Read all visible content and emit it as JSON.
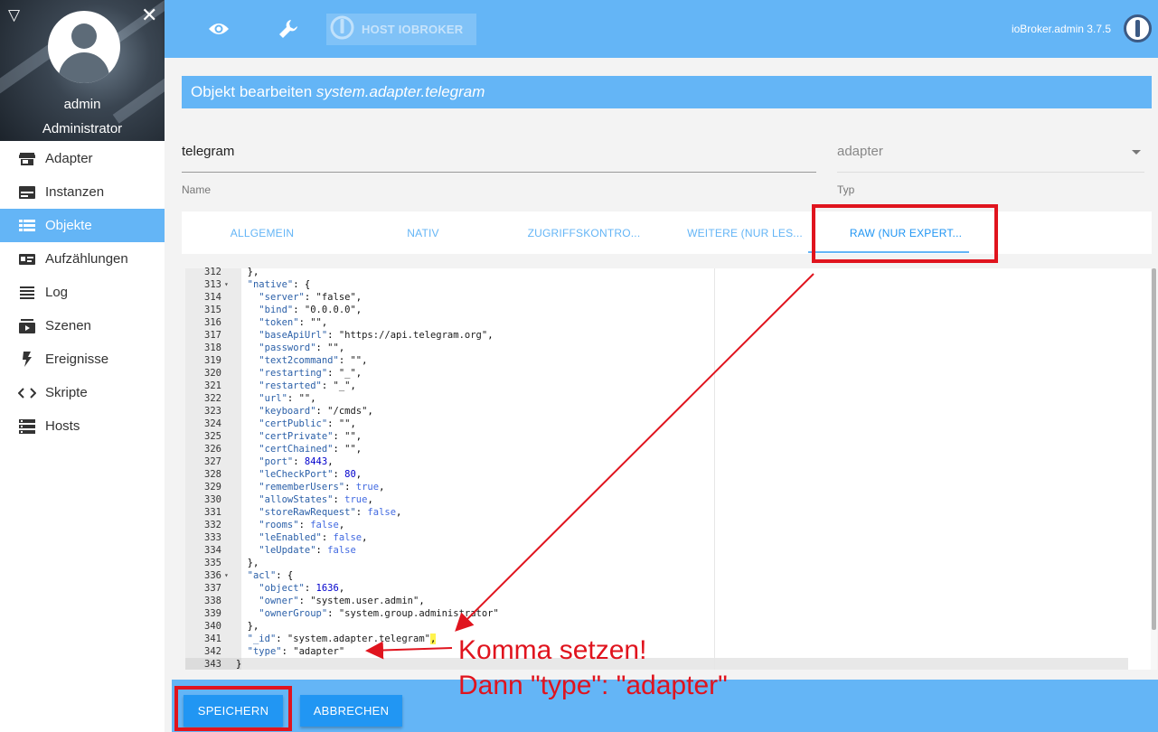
{
  "sidebar": {
    "user_name": "admin",
    "user_role": "Administrator",
    "items": [
      {
        "label": "Adapter",
        "icon": "store-icon"
      },
      {
        "label": "Instanzen",
        "icon": "instances-icon"
      },
      {
        "label": "Objekte",
        "icon": "list-icon",
        "active": true
      },
      {
        "label": "Aufzählungen",
        "icon": "enum-icon"
      },
      {
        "label": "Log",
        "icon": "log-icon"
      },
      {
        "label": "Szenen",
        "icon": "scenes-icon"
      },
      {
        "label": "Ereignisse",
        "icon": "flash-icon"
      },
      {
        "label": "Skripte",
        "icon": "code-icon"
      },
      {
        "label": "Hosts",
        "icon": "hosts-icon"
      }
    ]
  },
  "header": {
    "host_label": "HOST IOBROKER",
    "version": "ioBroker.admin 3.7.5"
  },
  "dialog": {
    "title_prefix": "Objekt bearbeiten ",
    "title_object": "system.adapter.telegram",
    "name_value": "telegram",
    "name_label": "Name",
    "type_value": "adapter",
    "type_label": "Typ",
    "tabs": [
      "ALLGEMEIN",
      "NATIV",
      "ZUGRIFFSKONTRO...",
      "WEITERE (NUR LES...",
      "RAW (NUR EXPERT..."
    ],
    "active_tab": 4,
    "save_label": "SPEICHERN",
    "cancel_label": "ABBRECHEN"
  },
  "editor": {
    "lines": [
      {
        "n": "312",
        "t": "  },"
      },
      {
        "n": "313",
        "fold": true,
        "t": "  \"native\": {"
      },
      {
        "n": "314",
        "t": "    \"server\": \"false\","
      },
      {
        "n": "315",
        "t": "    \"bind\": \"0.0.0.0\","
      },
      {
        "n": "316",
        "t": "    \"token\": \"\","
      },
      {
        "n": "317",
        "t": "    \"baseApiUrl\": \"https://api.telegram.org\","
      },
      {
        "n": "318",
        "t": "    \"password\": \"\","
      },
      {
        "n": "319",
        "t": "    \"text2command\": \"\","
      },
      {
        "n": "320",
        "t": "    \"restarting\": \"_\","
      },
      {
        "n": "321",
        "t": "    \"restarted\": \"_\","
      },
      {
        "n": "322",
        "t": "    \"url\": \"\","
      },
      {
        "n": "323",
        "t": "    \"keyboard\": \"/cmds\","
      },
      {
        "n": "324",
        "t": "    \"certPublic\": \"\","
      },
      {
        "n": "325",
        "t": "    \"certPrivate\": \"\","
      },
      {
        "n": "326",
        "t": "    \"certChained\": \"\","
      },
      {
        "n": "327",
        "t": "    \"port\": 8443,"
      },
      {
        "n": "328",
        "t": "    \"leCheckPort\": 80,"
      },
      {
        "n": "329",
        "t": "    \"rememberUsers\": true,"
      },
      {
        "n": "330",
        "t": "    \"allowStates\": true,"
      },
      {
        "n": "331",
        "t": "    \"storeRawRequest\": false,"
      },
      {
        "n": "332",
        "t": "    \"rooms\": false,"
      },
      {
        "n": "333",
        "t": "    \"leEnabled\": false,"
      },
      {
        "n": "334",
        "t": "    \"leUpdate\": false"
      },
      {
        "n": "335",
        "t": "  },"
      },
      {
        "n": "336",
        "fold": true,
        "t": "  \"acl\": {"
      },
      {
        "n": "337",
        "t": "    \"object\": 1636,"
      },
      {
        "n": "338",
        "t": "    \"owner\": \"system.user.admin\","
      },
      {
        "n": "339",
        "t": "    \"ownerGroup\": \"system.group.administrator\""
      },
      {
        "n": "340",
        "t": "  },"
      },
      {
        "n": "341",
        "t": "  \"_id\": \"system.adapter.telegram\"",
        "hl": ","
      },
      {
        "n": "342",
        "t": "  \"type\": \"adapter\""
      },
      {
        "n": "343",
        "t": "}"
      }
    ]
  },
  "annotation": {
    "line1": "Komma setzen!",
    "line2": "Dann \"type\": \"adapter\"",
    "color": "#e0141e"
  },
  "colors": {
    "accent": "#64b5f6",
    "button": "#2196f3"
  }
}
